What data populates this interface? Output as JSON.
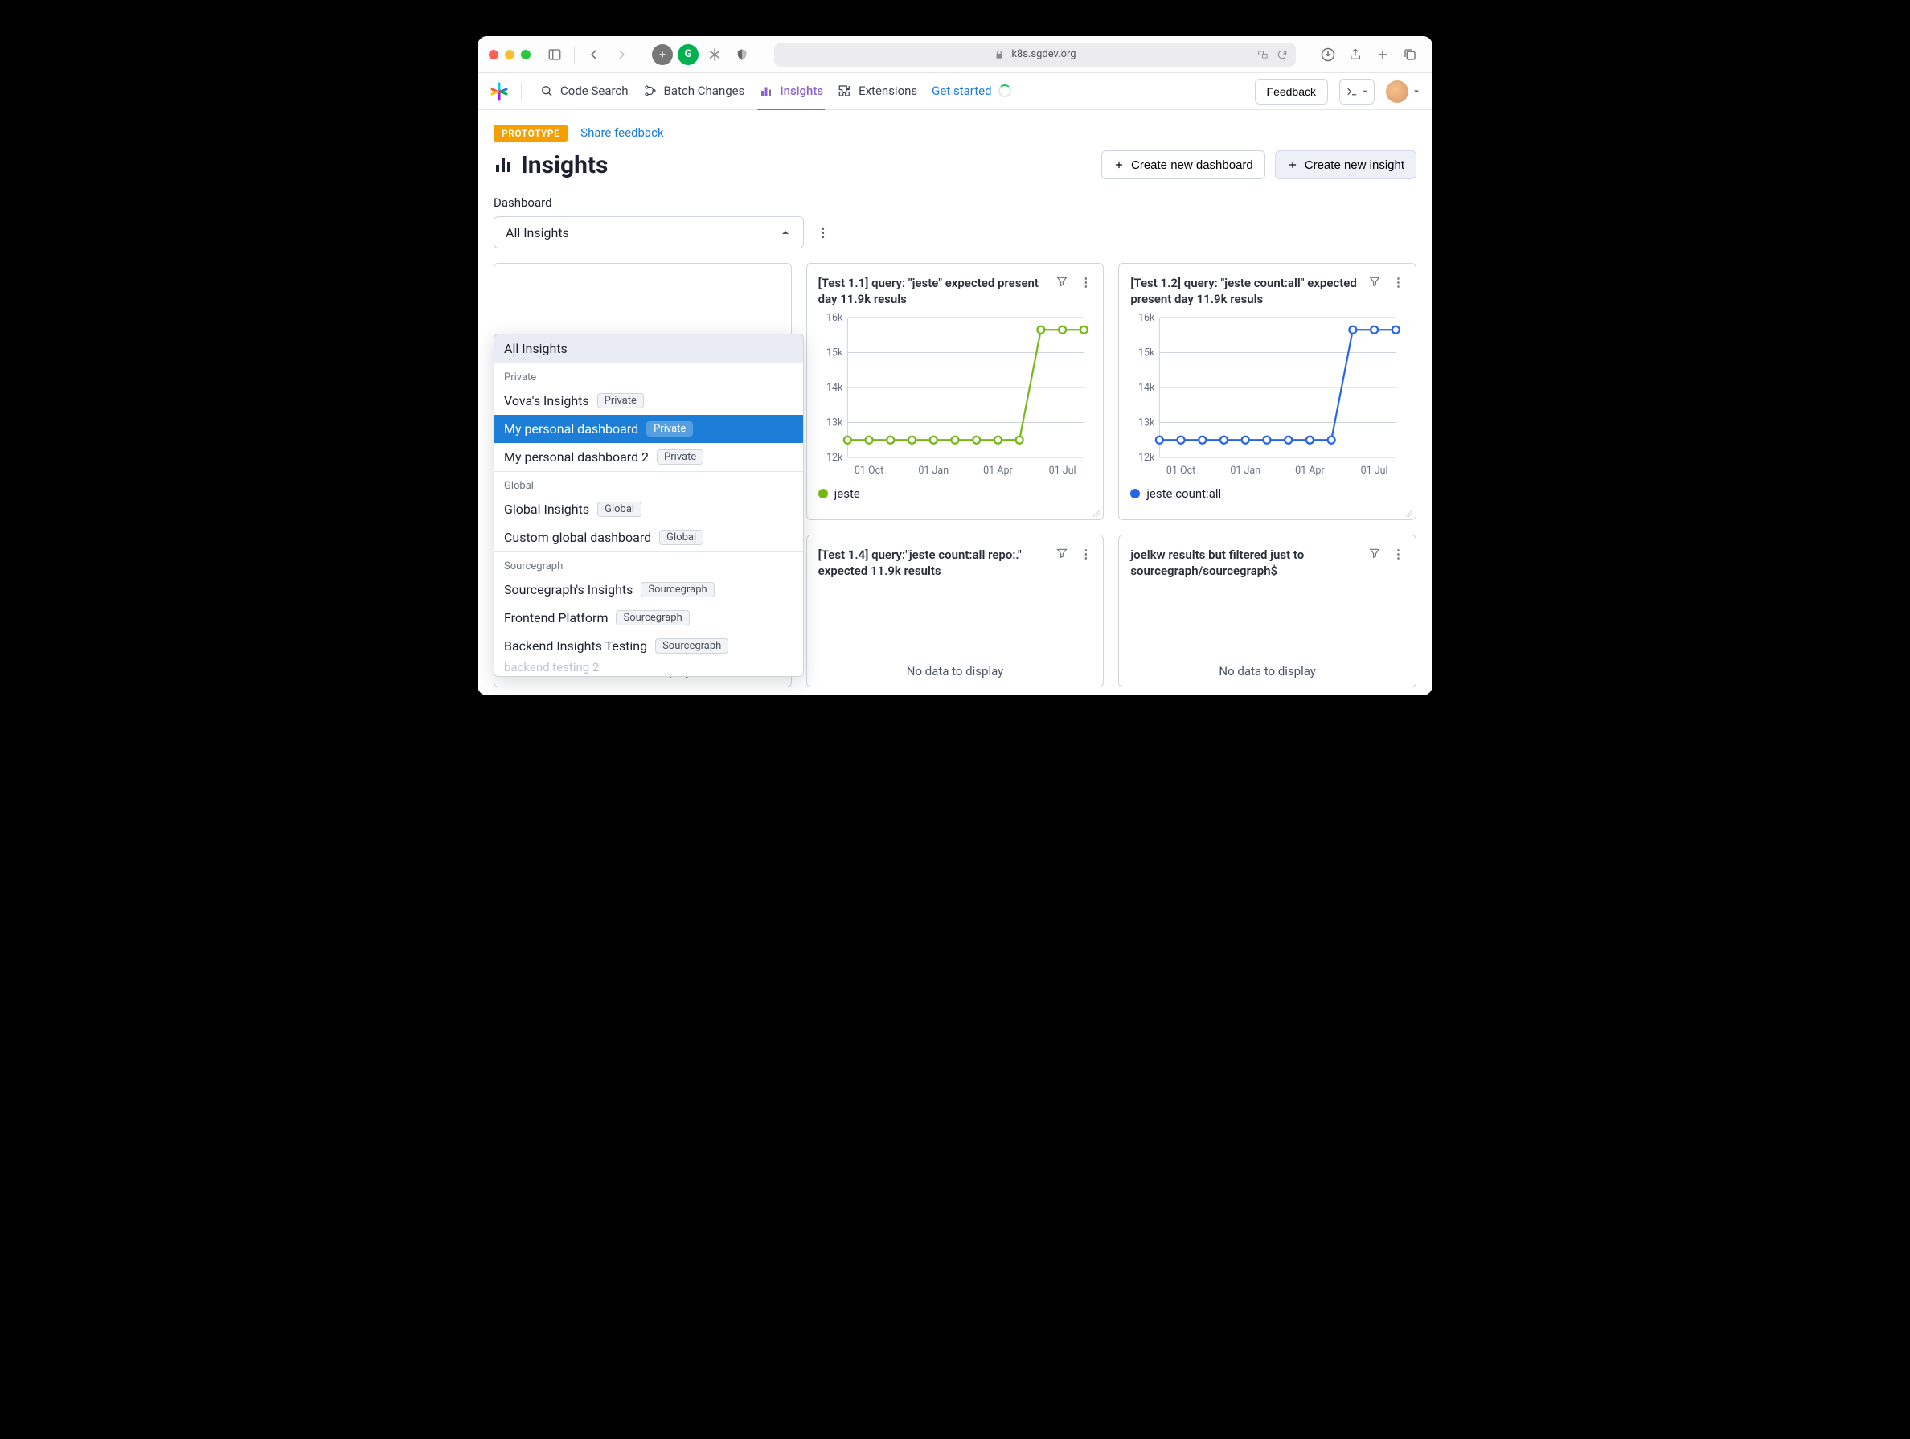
{
  "browser": {
    "url_host": "k8s.sgdev.org"
  },
  "nav": {
    "code_search": "Code Search",
    "batch_changes": "Batch Changes",
    "insights": "Insights",
    "extensions": "Extensions",
    "get_started": "Get started",
    "feedback": "Feedback"
  },
  "page": {
    "prototype_badge": "PROTOTYPE",
    "share_feedback": "Share feedback",
    "title": "Insights",
    "create_dashboard": "Create new dashboard",
    "create_insight": "Create new insight",
    "dashboard_label": "Dashboard",
    "selector_value": "All Insights"
  },
  "dropdown": {
    "all": "All Insights",
    "groups": [
      {
        "label": "Private",
        "items": [
          {
            "label": "Vova's Insights",
            "tag": "Private"
          },
          {
            "label": "My personal dashboard",
            "tag": "Private",
            "selected": true
          },
          {
            "label": "My personal dashboard 2",
            "tag": "Private"
          }
        ]
      },
      {
        "label": "Global",
        "items": [
          {
            "label": "Global Insights",
            "tag": "Global"
          },
          {
            "label": "Custom global dashboard",
            "tag": "Global"
          }
        ]
      },
      {
        "label": "Sourcegraph",
        "items": [
          {
            "label": "Sourcegraph's Insights",
            "tag": "Sourcegraph"
          },
          {
            "label": "Frontend Platform",
            "tag": "Sourcegraph"
          },
          {
            "label": "Backend Insights Testing",
            "tag": "Sourcegraph"
          }
        ]
      }
    ],
    "cutoff_preview": "backend testing 2"
  },
  "cards": {
    "c11": {
      "title": "[Test 1.1] query: \"jeste\" expected present day 11.9k resuls",
      "legend": "jeste",
      "color": "#74b816"
    },
    "c12": {
      "title": "[Test 1.2] query: \"jeste count:all\" expected present day 11.9k resuls",
      "legend": "jeste count:all",
      "color": "#2563eb"
    },
    "c14": {
      "title": "[Test 1.4] query:\"jeste count:all repo:.\" expected 11.9k results"
    },
    "c_joel": {
      "title": "joelkw results but filtered just to sourcegraph/sourcegraph$"
    },
    "nodata": "No data to display"
  },
  "chart_data": [
    {
      "id": "c11",
      "type": "line",
      "ylim": [
        12000,
        16000
      ],
      "y_ticks": [
        12000,
        13000,
        14000,
        15000,
        16000
      ],
      "y_tick_labels": [
        "12k",
        "13k",
        "14k",
        "15k",
        "16k"
      ],
      "x_tick_labels": [
        "01 Oct",
        "01 Jan",
        "01 Apr",
        "01 Jul"
      ],
      "x": [
        0,
        1,
        2,
        3,
        4,
        5,
        6,
        7,
        8,
        9,
        10,
        11
      ],
      "series": [
        {
          "name": "jeste",
          "color": "#74b816",
          "values": [
            12500,
            12500,
            12500,
            12500,
            12500,
            12500,
            12500,
            12500,
            12500,
            15650,
            15650,
            15650
          ]
        }
      ]
    },
    {
      "id": "c12",
      "type": "line",
      "ylim": [
        12000,
        16000
      ],
      "y_ticks": [
        12000,
        13000,
        14000,
        15000,
        16000
      ],
      "y_tick_labels": [
        "12k",
        "13k",
        "14k",
        "15k",
        "16k"
      ],
      "x_tick_labels": [
        "01 Oct",
        "01 Jan",
        "01 Apr",
        "01 Jul"
      ],
      "x": [
        0,
        1,
        2,
        3,
        4,
        5,
        6,
        7,
        8,
        9,
        10,
        11
      ],
      "series": [
        {
          "name": "jeste count:all",
          "color": "#2563eb",
          "values": [
            12500,
            12500,
            12500,
            12500,
            12500,
            12500,
            12500,
            12500,
            12500,
            15650,
            15650,
            15650
          ]
        }
      ]
    }
  ]
}
